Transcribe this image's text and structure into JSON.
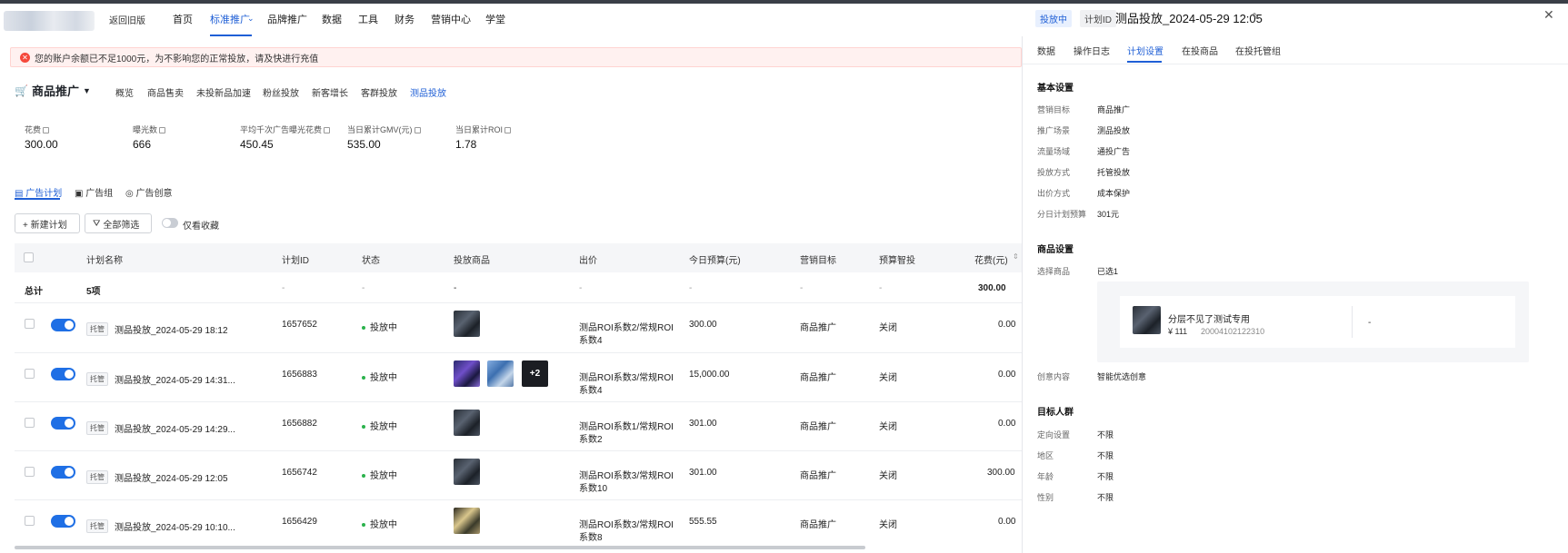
{
  "nav": {
    "back": "返回旧版",
    "items": [
      "首页",
      "标准推广",
      "品牌推广",
      "数据",
      "工具",
      "财务",
      "营销中心",
      "学堂"
    ],
    "active_index": 1
  },
  "alert": {
    "text": "您的账户余额已不足1000元，为不影响您的正常投放，请及快进行充值"
  },
  "product": {
    "title": "商品推广",
    "subnav": [
      "概览",
      "商品售卖",
      "未投新品加速",
      "粉丝投放",
      "新客增长",
      "客群投放",
      "测品投放"
    ],
    "active_subnav": 6
  },
  "stats": [
    {
      "label": "花费",
      "value": "300.00"
    },
    {
      "label": "曝光数",
      "value": "666"
    },
    {
      "label": "平均千次广告曝光花费",
      "value": "450.45"
    },
    {
      "label": "当日累计GMV(元)",
      "value": "535.00"
    },
    {
      "label": "当日累计ROI",
      "value": "1.78"
    }
  ],
  "tabs": [
    "广告计划",
    "广告组",
    "广告创意"
  ],
  "toolbar": {
    "new_plan": "+ 新建计划",
    "filter": "全部筛选",
    "fav": "仅看收藏"
  },
  "table": {
    "headers": [
      "计划名称",
      "计划ID",
      "状态",
      "投放商品",
      "出价",
      "今日预算(元)",
      "营销目标",
      "预算智投",
      "花费(元)"
    ],
    "total": {
      "label": "总计",
      "count": "5项",
      "dash": "-",
      "goods_dash": "-",
      "cost": "300.00"
    },
    "rows": [
      {
        "tag": "托管",
        "name": "测品投放_2024-05-29 18:12",
        "id": "1657652",
        "status": "投放中",
        "bid1": "测品ROI系数2/常规ROI",
        "bid2": "系数4",
        "budget": "300.00",
        "goal": "商品推广",
        "smart": "关闭",
        "cost": "0.00"
      },
      {
        "tag": "托管",
        "name": "测品投放_2024-05-29 14:31...",
        "id": "1656883",
        "status": "投放中",
        "bid1": "测品ROI系数3/常规ROI",
        "bid2": "系数4",
        "budget": "15,000.00",
        "goal": "商品推广",
        "smart": "关闭",
        "cost": "0.00",
        "more": "+2"
      },
      {
        "tag": "托管",
        "name": "测品投放_2024-05-29 14:29...",
        "id": "1656882",
        "status": "投放中",
        "bid1": "测品ROI系数1/常规ROI",
        "bid2": "系数2",
        "budget": "301.00",
        "goal": "商品推广",
        "smart": "关闭",
        "cost": "0.00"
      },
      {
        "tag": "托管",
        "name": "测品投放_2024-05-29 12:05",
        "id": "1656742",
        "status": "投放中",
        "bid1": "测品ROI系数3/常规ROI",
        "bid2": "系数10",
        "budget": "301.00",
        "goal": "商品推广",
        "smart": "关闭",
        "cost": "300.00"
      },
      {
        "tag": "托管",
        "name": "测品投放_2024-05-29 10:10...",
        "id": "1656429",
        "status": "投放中",
        "bid1": "测品ROI系数3/常规ROI",
        "bid2": "系数8",
        "budget": "555.55",
        "goal": "商品推广",
        "smart": "关闭",
        "cost": "0.00"
      }
    ]
  },
  "panel": {
    "status": "投放中",
    "id_tag": "计划ID",
    "title": "测品投放_2024-05-29 12:05",
    "tabs": [
      "数据",
      "操作日志",
      "计划设置",
      "在投商品",
      "在投托管组"
    ],
    "active_tab": 2,
    "basic": {
      "title": "基本设置",
      "fields": [
        {
          "label": "营销目标",
          "value": "商品推广"
        },
        {
          "label": "推广场景",
          "value": "测品投放"
        },
        {
          "label": "流量场域",
          "value": "通投广告"
        },
        {
          "label": "投放方式",
          "value": "托管投放"
        },
        {
          "label": "出价方式",
          "value": "成本保护"
        },
        {
          "label": "分日计划预算",
          "value": "301元"
        }
      ]
    },
    "goods": {
      "title": "商品设置",
      "select_label": "选择商品",
      "select_value": "已选1",
      "item_name": "分层不见了测试专用",
      "item_price": "¥ 111",
      "item_id": "20004102122310",
      "item_dash": "-",
      "creative_label": "创意内容",
      "creative_value": "智能优选创意"
    },
    "audience": {
      "title": "目标人群",
      "fields": [
        {
          "label": "定向设置",
          "value": "不限"
        },
        {
          "label": "地区",
          "value": "不限"
        },
        {
          "label": "年龄",
          "value": "不限"
        },
        {
          "label": "性别",
          "value": "不限"
        }
      ]
    }
  }
}
